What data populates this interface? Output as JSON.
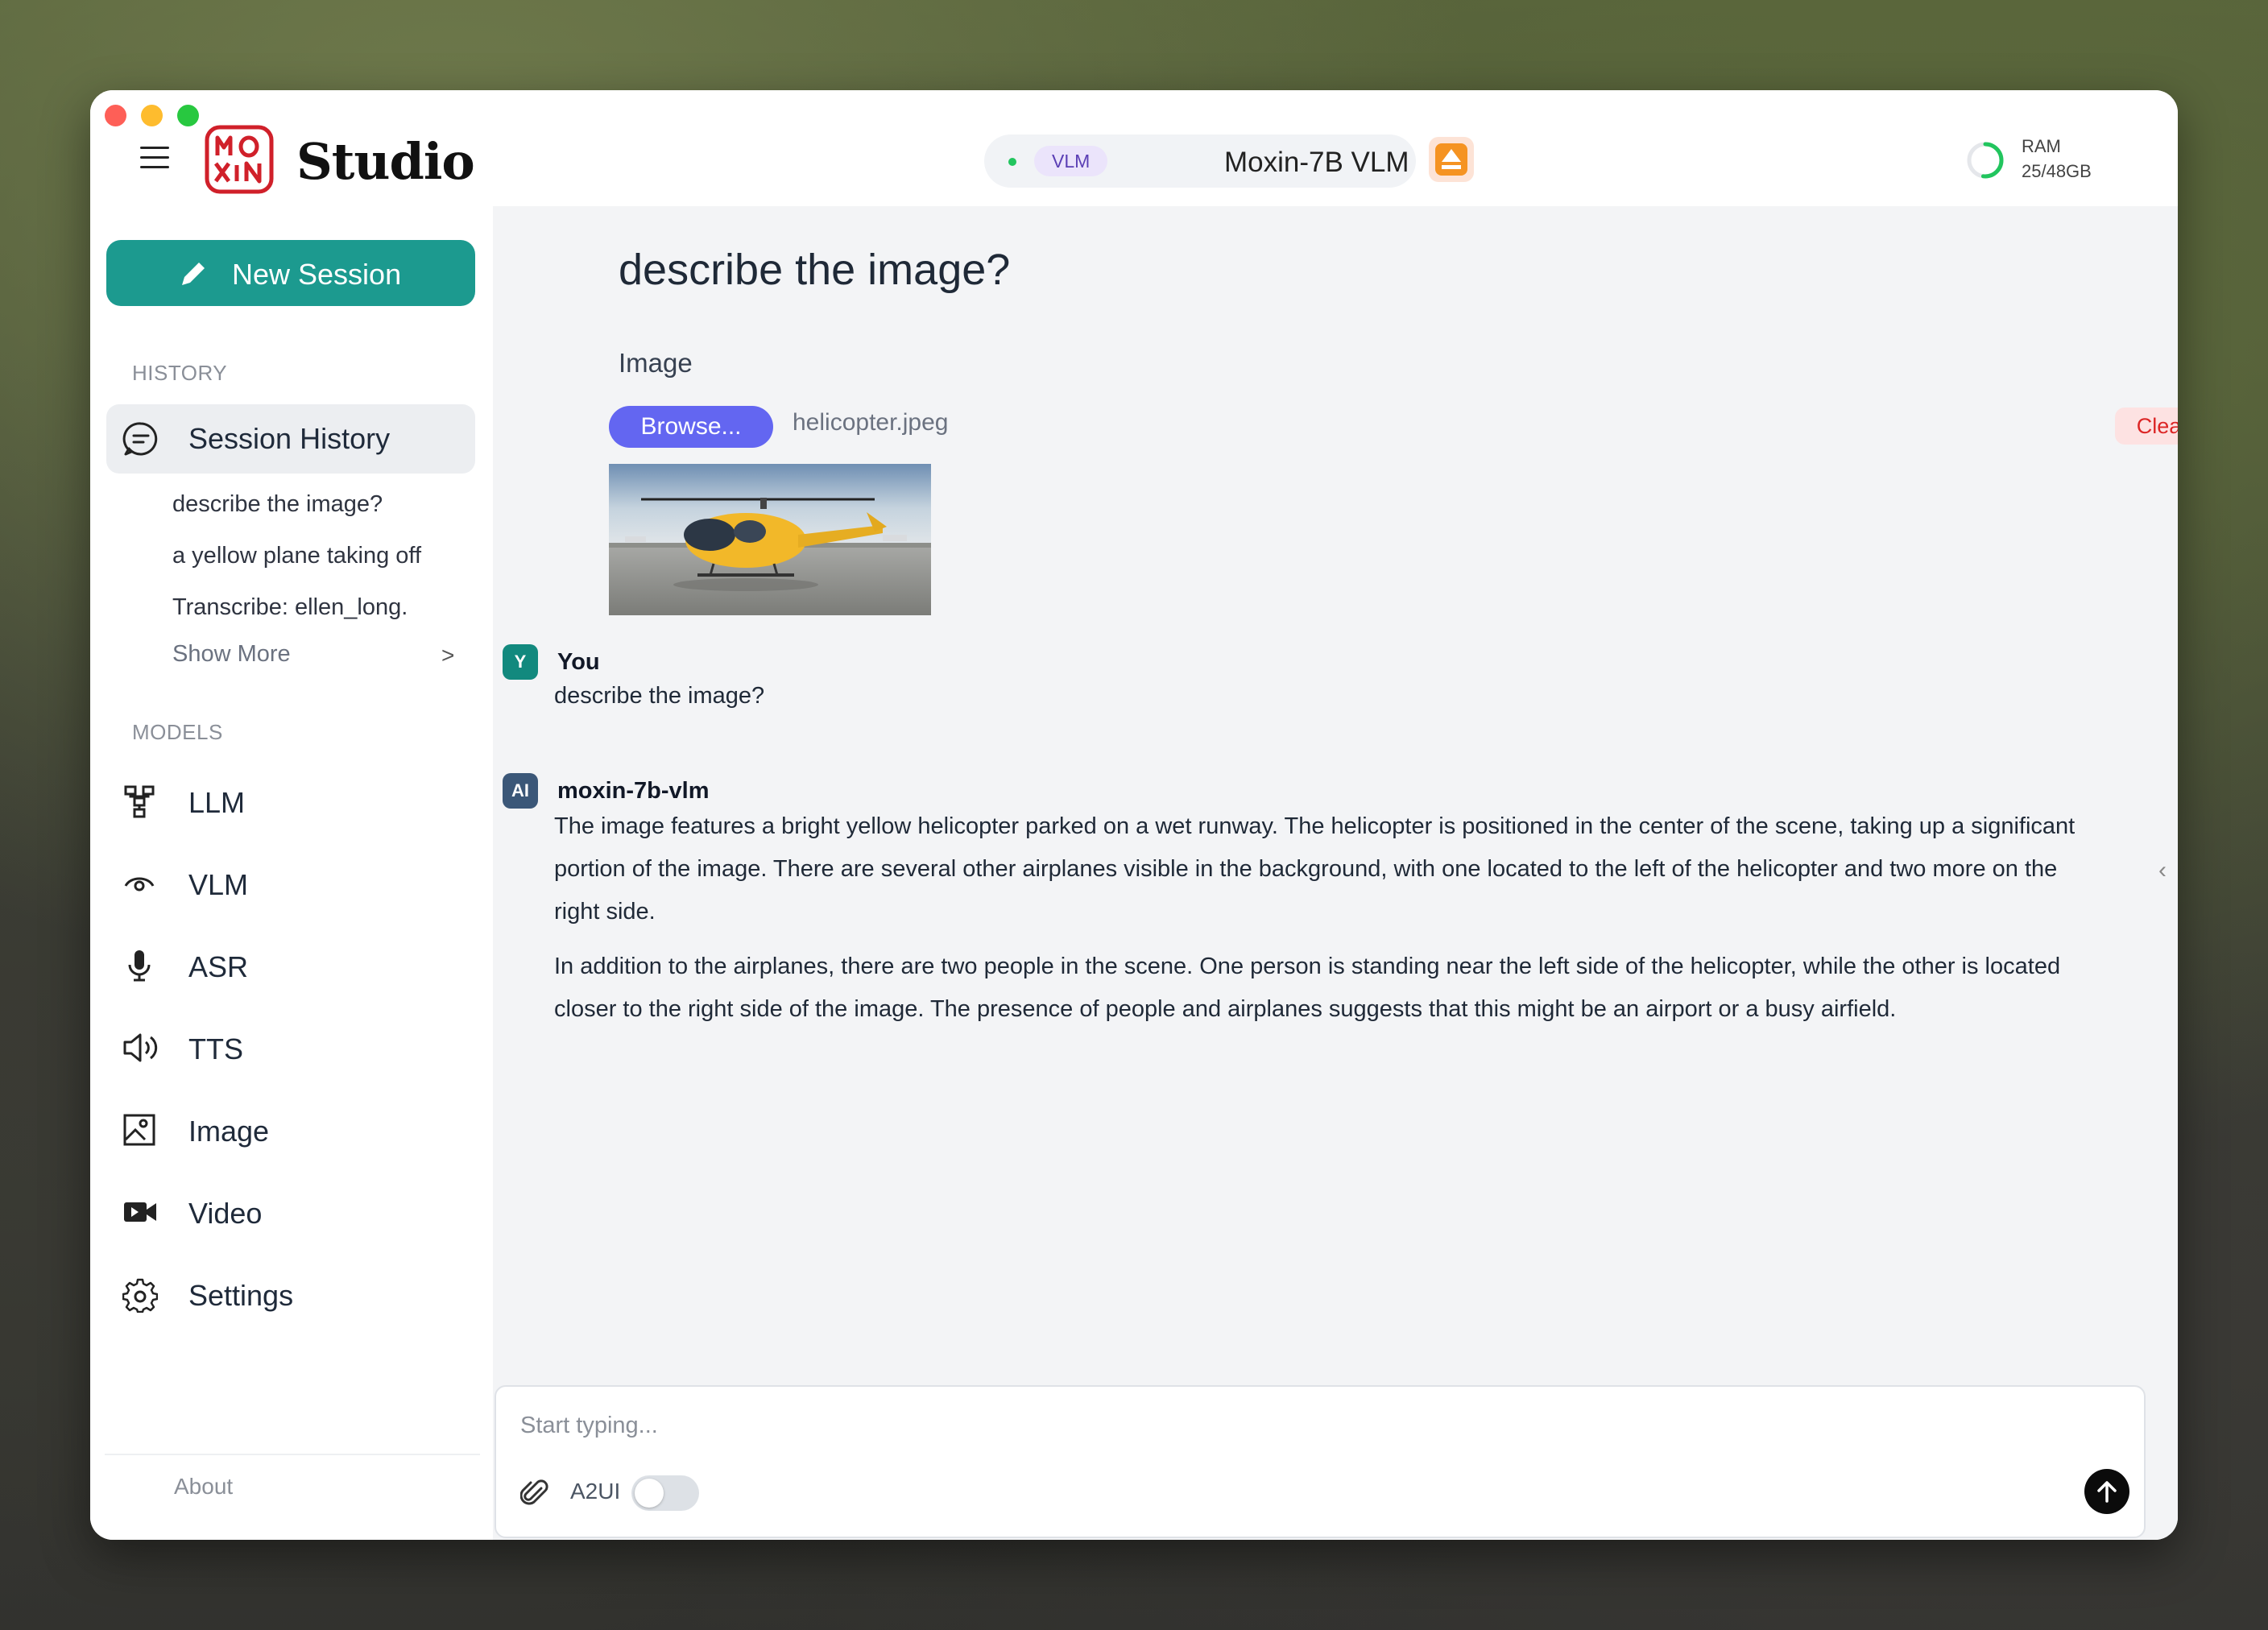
{
  "app": {
    "title": "Studio",
    "logo_text": "MO XiN"
  },
  "header": {
    "model_tag": "VLM",
    "model_name": "Moxin-7B VLM",
    "ram_label": "RAM",
    "ram_value": "25/48GB",
    "ram_used_fraction": 0.52
  },
  "sidebar": {
    "new_session_label": "New Session",
    "history_heading": "HISTORY",
    "history_active_label": "Session History",
    "history_items": [
      "describe the image?",
      "a yellow plane taking off",
      "Transcribe: ellen_long."
    ],
    "show_more_label": "Show More",
    "models_heading": "MODELS",
    "nav": [
      {
        "label": "LLM",
        "icon": "network-icon"
      },
      {
        "label": "VLM",
        "icon": "eye-icon"
      },
      {
        "label": "ASR",
        "icon": "microphone-icon"
      },
      {
        "label": "TTS",
        "icon": "speaker-icon"
      },
      {
        "label": "Image",
        "icon": "image-icon"
      },
      {
        "label": "Video",
        "icon": "video-camera-icon"
      },
      {
        "label": "Settings",
        "icon": "gear-icon"
      }
    ],
    "about_label": "About"
  },
  "chat": {
    "title": "describe the image?",
    "image_section_label": "Image",
    "browse_label": "Browse...",
    "file_name": "helicopter.jpeg",
    "clear_label": "Clear",
    "messages": [
      {
        "avatar": "Y",
        "sender": "You",
        "text": "describe the image?"
      },
      {
        "avatar": "AI",
        "sender": "moxin-7b-vlm",
        "paragraphs": [
          "The image features a bright yellow helicopter parked on a wet runway. The helicopter is positioned in the center of the scene, taking up a significant portion of the image. There are several other airplanes visible in the background, with one located to the left of the helicopter and two more on the right side.",
          "In addition to the airplanes, there are two people in the scene. One person is standing near the left side of the helicopter, while the other is located closer to the right side of the image. The presence of people and airplanes suggests that this might be an airport or a busy airfield."
        ]
      }
    ]
  },
  "input": {
    "placeholder": "Start typing...",
    "a2ui_label": "A2UI",
    "a2ui_enabled": false
  },
  "colors": {
    "accent_teal": "#1c9a8f",
    "browse_indigo": "#6366f1",
    "clear_red": "#dc2626",
    "status_green": "#22c55e"
  }
}
